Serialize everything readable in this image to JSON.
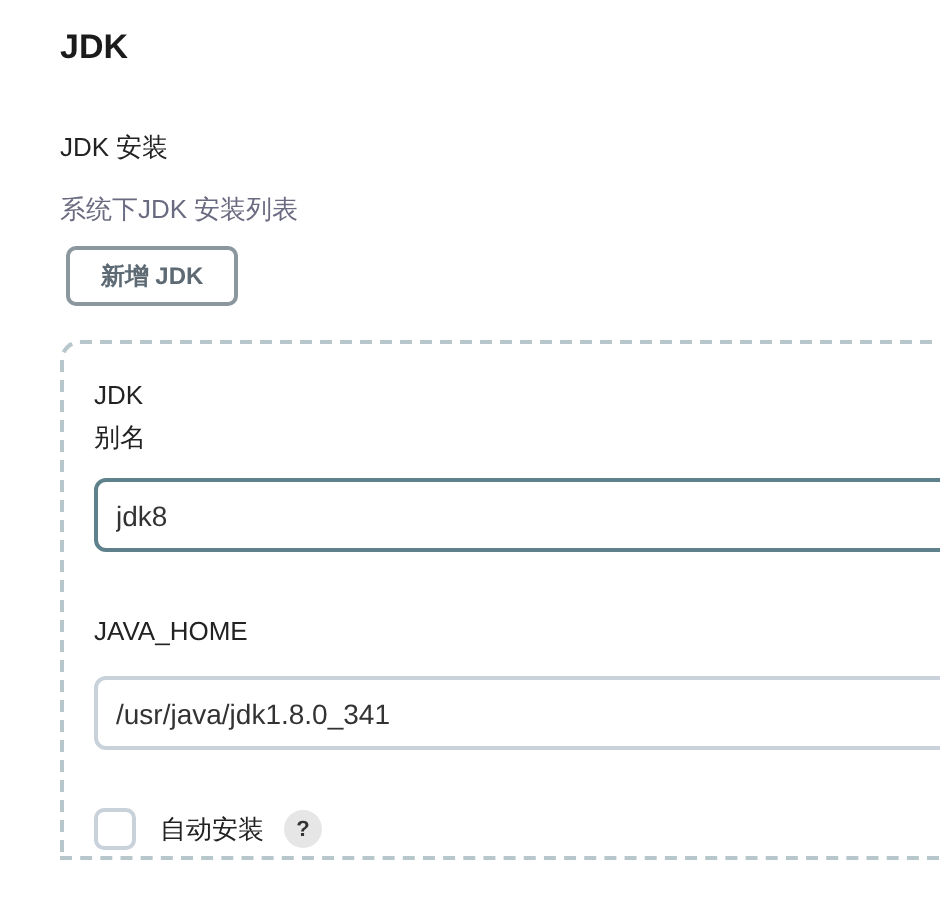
{
  "heading": "JDK",
  "section_label": "JDK 安装",
  "description": "系统下JDK 安装列表",
  "add_button": "新增 JDK",
  "installation": {
    "name_label_lines": [
      "JDK",
      "别名"
    ],
    "name_field": {
      "value": "jdk8",
      "focused": true
    },
    "home_label": "JAVA_HOME",
    "home_field": {
      "value": "/usr/java/jdk1.8.0_341",
      "focused": false
    },
    "auto_install": {
      "label": "自动安装",
      "checked": false,
      "help": "?"
    }
  }
}
